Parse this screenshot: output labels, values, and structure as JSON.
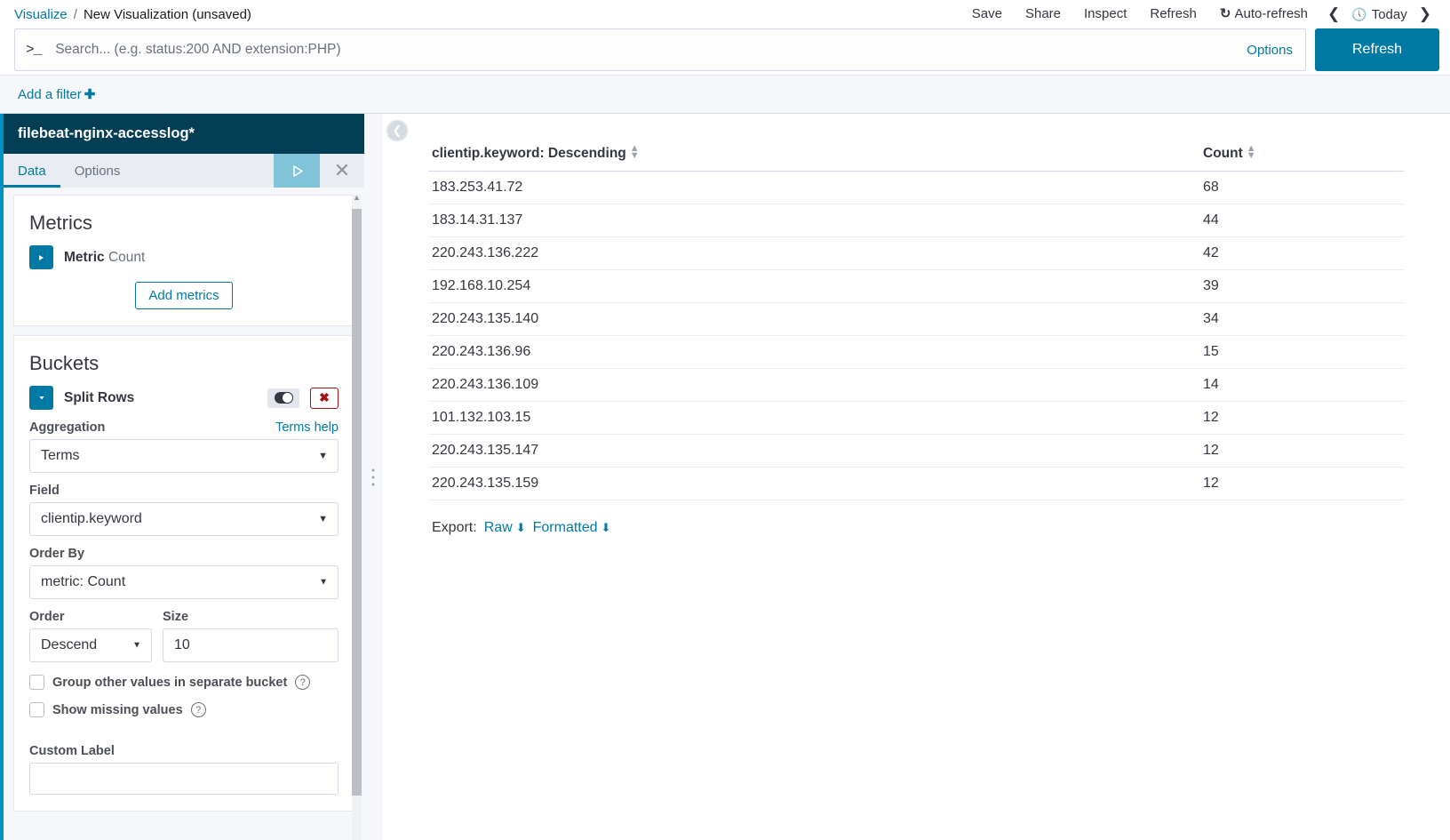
{
  "breadcrumb": {
    "root": "Visualize",
    "separator": "/",
    "current": "New Visualization (unsaved)"
  },
  "topnav": {
    "save": "Save",
    "share": "Share",
    "inspect": "Inspect",
    "refresh": "Refresh",
    "auto_refresh": "Auto-refresh",
    "auto_refresh_icon": "refresh-cycle-icon",
    "prev_icon": "chevron-left-icon",
    "next_icon": "chevron-right-icon",
    "time_icon": "clock-icon",
    "time_range": "Today"
  },
  "query": {
    "prompt_icon": ">_",
    "placeholder": "Search... (e.g. status:200 AND extension:PHP)",
    "value": "",
    "options_label": "Options",
    "refresh_label": "Refresh"
  },
  "filters": {
    "add_filter_label": "Add a filter",
    "add_icon": "plus-icon"
  },
  "sidebar": {
    "index_pattern": "filebeat-nginx-accesslog*",
    "tabs": [
      {
        "label": "Data",
        "active": true
      },
      {
        "label": "Options",
        "active": false
      }
    ],
    "apply_icon": "play-icon",
    "close_icon": "close-icon",
    "metrics": {
      "title": "Metrics",
      "expand_icon": "caret-right-icon",
      "agg_type": "Metric",
      "agg_value": "Count",
      "add_metrics_label": "Add metrics"
    },
    "buckets": {
      "title": "Buckets",
      "expand_icon": "caret-down-icon",
      "bucket_type": "Split Rows",
      "toggle_icon": "toggle-switch-icon",
      "delete_icon": "delete-x-icon",
      "aggregation_label": "Aggregation",
      "aggregation_help": "Terms help",
      "aggregation_value": "Terms",
      "field_label": "Field",
      "field_value": "clientip.keyword",
      "order_by_label": "Order By",
      "order_by_value": "metric: Count",
      "order_label": "Order",
      "order_value": "Descend",
      "size_label": "Size",
      "size_value": "10",
      "group_other_label": "Group other values in separate bucket",
      "group_other_checked": false,
      "show_missing_label": "Show missing values",
      "show_missing_checked": false,
      "help_icon": "question-mark-icon",
      "custom_label_label": "Custom Label",
      "custom_label_value": ""
    }
  },
  "content": {
    "collapse_icon": "chevron-left-circle-icon",
    "export_label": "Export:",
    "export_raw": "Raw",
    "export_formatted": "Formatted",
    "download_icon": "download-icon"
  },
  "chart_data": {
    "type": "table",
    "title": "",
    "columns": [
      "clientip.keyword: Descending",
      "Count"
    ],
    "categories": [
      "183.253.41.72",
      "183.14.31.137",
      "220.243.136.222",
      "192.168.10.254",
      "220.243.135.140",
      "220.243.136.96",
      "220.243.136.109",
      "101.132.103.15",
      "220.243.135.147",
      "220.243.135.159"
    ],
    "values": [
      68,
      44,
      42,
      39,
      34,
      15,
      14,
      12,
      12,
      12
    ],
    "rows": [
      {
        "key": "183.253.41.72",
        "count": "68"
      },
      {
        "key": "183.14.31.137",
        "count": "44"
      },
      {
        "key": "220.243.136.222",
        "count": "42"
      },
      {
        "key": "192.168.10.254",
        "count": "39"
      },
      {
        "key": "220.243.135.140",
        "count": "34"
      },
      {
        "key": "220.243.136.96",
        "count": "15"
      },
      {
        "key": "220.243.136.109",
        "count": "14"
      },
      {
        "key": "101.132.103.15",
        "count": "12"
      },
      {
        "key": "220.243.135.147",
        "count": "12"
      },
      {
        "key": "220.243.135.159",
        "count": "12"
      }
    ],
    "xlabel": "clientip.keyword",
    "ylabel": "Count"
  },
  "colors": {
    "accent": "#0079a5",
    "header_dark": "#043e55",
    "edge_stripe": "#0091c4",
    "danger": "#a3100f",
    "apply_button": "#81c3d8"
  }
}
